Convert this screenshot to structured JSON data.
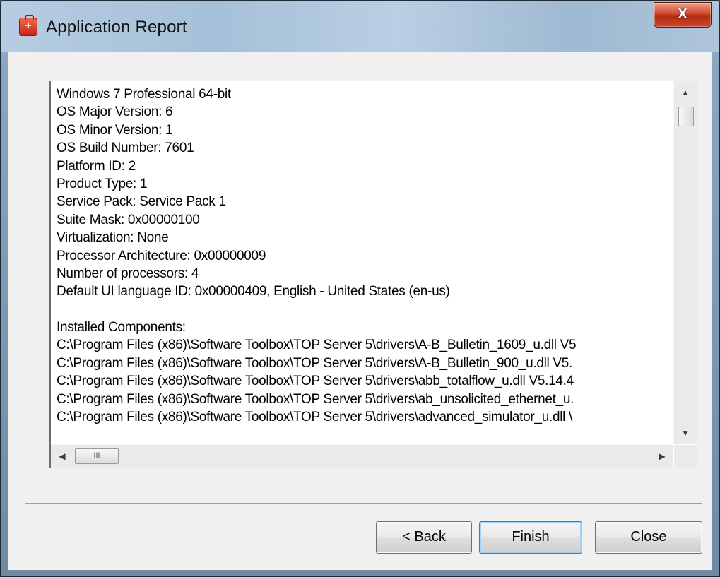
{
  "window": {
    "title": "Application Report",
    "close_glyph": "X",
    "icon": "briefcase-red-icon"
  },
  "report": {
    "lines": [
      "Windows 7 Professional 64-bit",
      "OS Major Version: 6",
      "OS Minor Version: 1",
      "OS Build Number: 7601",
      "Platform ID: 2",
      "Product Type: 1",
      "Service Pack: Service Pack 1",
      "Suite Mask: 0x00000100",
      "Virtualization: None",
      "Processor Architecture: 0x00000009",
      "Number of processors: 4",
      "Default UI language ID: 0x00000409, English - United States (en-us)",
      "",
      "Installed Components:",
      "C:\\Program Files (x86)\\Software Toolbox\\TOP Server 5\\drivers\\A-B_Bulletin_1609_u.dll V5",
      "C:\\Program Files (x86)\\Software Toolbox\\TOP Server 5\\drivers\\A-B_Bulletin_900_u.dll V5.",
      "C:\\Program Files (x86)\\Software Toolbox\\TOP Server 5\\drivers\\abb_totalflow_u.dll V5.14.4",
      "C:\\Program Files (x86)\\Software Toolbox\\TOP Server 5\\drivers\\ab_unsolicited_ethernet_u.",
      "C:\\Program Files (x86)\\Software Toolbox\\TOP Server 5\\drivers\\advanced_simulator_u.dll \\"
    ]
  },
  "scrollbars": {
    "up_arrow": "▲",
    "down_arrow": "▼",
    "left_arrow": "◀",
    "right_arrow": "▶",
    "h_thumb_grip": "III"
  },
  "buttons": {
    "back_label": "< Back",
    "finish_label": "Finish",
    "close_label": "Close"
  },
  "colors": {
    "dialog_bg": "#f0f0f0",
    "close_button": "#c9472c",
    "default_button_border": "#3c7fb1"
  }
}
